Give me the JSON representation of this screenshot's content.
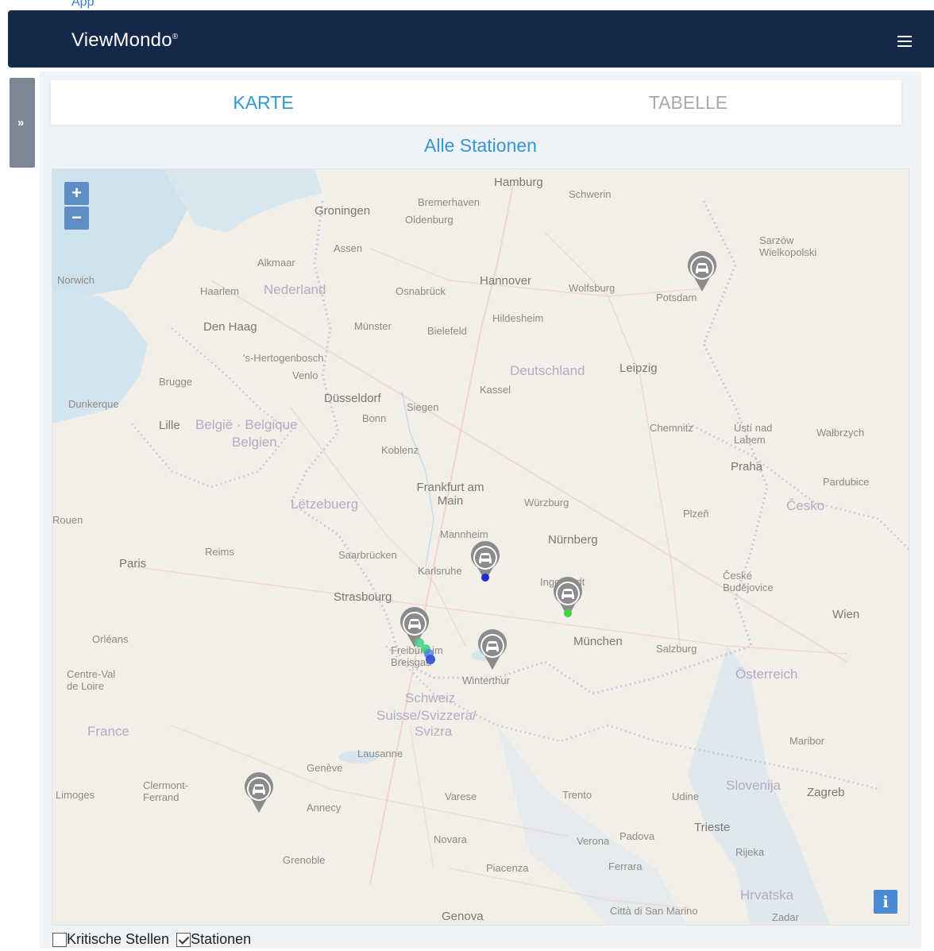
{
  "header": {
    "brand": "ViewMondo",
    "brand_mark": "®",
    "menu_icon": "hamburger-icon",
    "background": "#14284a"
  },
  "top_link": "App",
  "sidebar_toggle": {
    "label": "»"
  },
  "tabs": [
    {
      "label": "KARTE",
      "active": true
    },
    {
      "label": "TABELLE",
      "active": false
    }
  ],
  "map": {
    "title": "Alle Stationen",
    "zoom_in": "+",
    "zoom_out": "−",
    "info": "i",
    "places": {
      "hamburg": "Hamburg",
      "bremerhaven": "Bremerhaven",
      "schwerin": "Schwerin",
      "groningen": "Groningen",
      "oldenburg": "Oldenburg",
      "assen": "Assen",
      "alkmaar": "Alkmaar",
      "norwich": "Norwich",
      "haarlem": "Haarlem",
      "nederland": "Nederland",
      "osnabrueck": "Osnabrück",
      "hannover": "Hannover",
      "wolfsburg": "Wolfsburg",
      "potsdam": "Potsdam",
      "sarzow": "Sarzów Wielkopolski",
      "den_haag": "Den Haag",
      "muenster": "Münster",
      "bielefeld": "Bielefeld",
      "hildesheim": "Hildesheim",
      "hertogenbosch": "'s-Hertogenbosch",
      "venlo": "Venlo",
      "deutschland": "Deutschland",
      "leipzig": "Leipzig",
      "brugge": "Brugge",
      "duesseldorf": "Düsseldorf",
      "kassel": "Kassel",
      "dunkerque": "Dunkerque",
      "lille": "Lille",
      "belgie": "België · Belgique",
      "belgien": "Belgien",
      "bonn": "Bonn",
      "siegen": "Siegen",
      "chemnitz": "Chemnitz",
      "usti": "Ústí nad Labem",
      "walbrzych": "Wałbrzych",
      "koblenz": "Koblenz",
      "praha": "Praha",
      "frankfurt": "Frankfurt am Main",
      "wuerzburg": "Würzburg",
      "pardubice": "Pardubice",
      "rouen": "Rouen",
      "luxemburg": "Lëtzebuerg",
      "plzen": "Plzeň",
      "cesko": "Česko",
      "mannheim": "Mannheim",
      "nuernberg": "Nürnberg",
      "paris": "Paris",
      "reims": "Reims",
      "saarbruecken": "Saarbrücken",
      "karlsruhe": "Karlsruhe",
      "strasbourg": "Strasbourg",
      "ingolstadt": "Ingolstadt",
      "ceske": "České Budějovice",
      "wien": "Wien",
      "orleans": "Orléans",
      "muenchen": "München",
      "salzburg": "Salzburg",
      "freiburg": "Freiburg im Breisgau",
      "winterthur": "Winterthur",
      "oesterreich": "Österreich",
      "centre": "Centre-Val de Loire",
      "schweiz": "Schweiz",
      "suisse": "Suisse/Svizzera/",
      "svizra": "Svizra",
      "france": "France",
      "lausanne": "Lausanne",
      "geneve": "Genève",
      "maribor": "Maribor",
      "limoges": "Limoges",
      "clermont": "Clermont-Ferrand",
      "annecy": "Annecy",
      "varese": "Varese",
      "trento": "Trento",
      "udine": "Udine",
      "slovenija": "Slovenija",
      "zagreb": "Zagreb",
      "trieste": "Trieste",
      "grenoble": "Grenoble",
      "novara": "Novara",
      "verona": "Verona",
      "padova": "Padova",
      "rijeka": "Rijeka",
      "piacenza": "Piacenza",
      "ferrara": "Ferrara",
      "hrvatska": "Hrvatska",
      "genova": "Genova",
      "citta": "Città di San Marino",
      "zadar": "Zadar"
    },
    "markers": [
      {
        "name": "marker-berlin",
        "icon": "car-icon",
        "dot": null
      },
      {
        "name": "marker-karlsruhe",
        "icon": "car-icon",
        "dot": "#1f2fcf"
      },
      {
        "name": "marker-ingolstadt",
        "icon": "car-icon",
        "dot": "#3ed43e"
      },
      {
        "name": "marker-freiburg",
        "icon": "car-icon",
        "dot": "#3ed48a"
      },
      {
        "name": "marker-konstanz",
        "icon": "car-icon",
        "dot": null
      },
      {
        "name": "marker-lyon",
        "icon": "car-icon",
        "dot": null
      }
    ]
  },
  "legend": {
    "kritische": {
      "label": "Kritische Stellen",
      "checked": false
    },
    "stationen": {
      "label": "Stationen",
      "checked": true
    }
  }
}
